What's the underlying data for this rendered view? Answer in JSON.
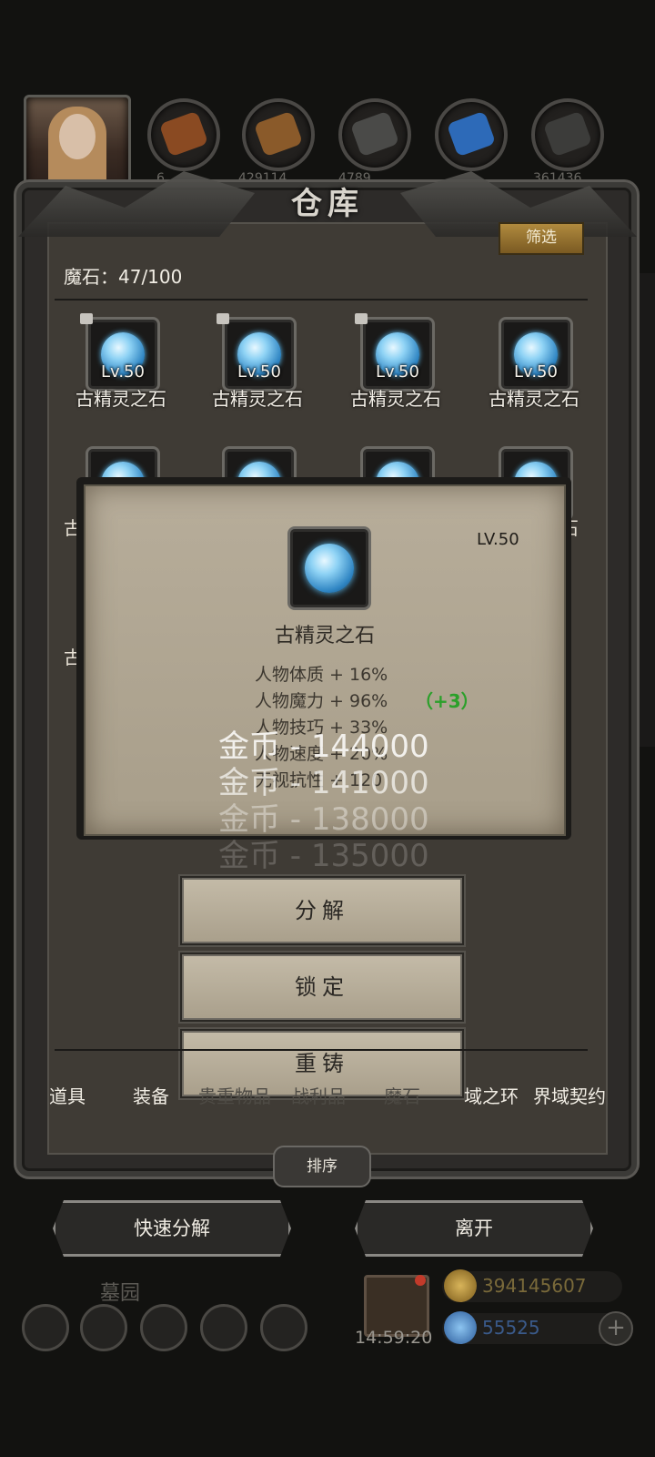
{
  "top_resources": {
    "values": [
      "6",
      "429114",
      "4789",
      "",
      "361436"
    ]
  },
  "panel": {
    "title": "仓库",
    "filter_label": "筛选",
    "stone_count": "魔石：47/100"
  },
  "grid_items": [
    {
      "level": "Lv.50",
      "name": "古精灵之石",
      "locked": true
    },
    {
      "level": "Lv.50",
      "name": "古精灵之石",
      "locked": true
    },
    {
      "level": "Lv.50",
      "name": "古精灵之石",
      "locked": true
    },
    {
      "level": "Lv.50",
      "name": "古精灵之石",
      "locked": false
    }
  ],
  "row2_partial_names": [
    "古",
    "石"
  ],
  "row3_partial_name": "古",
  "detail": {
    "level": "LV.50",
    "name": "古精灵之石",
    "stats": [
      "人物体质 + 16%",
      "人物魔力 + 96%",
      "人物技巧 + 33%",
      "人物速度 + 20%",
      "无视抗性 + 120"
    ],
    "bonus": "（+3）"
  },
  "gold_floats": [
    "金币 - 144000",
    "金币 - 141000",
    "金币 - 138000",
    "金币 - 135000"
  ],
  "actions": {
    "decompose": "分解",
    "lock": "锁定",
    "reforge": "重铸"
  },
  "tabs": [
    "道具",
    "装备",
    "贵重物品",
    "战利品",
    "魔石",
    "界域之环",
    "界域契约"
  ],
  "sort_label": "排序",
  "bottom_buttons": {
    "quick_decompose": "快速分解",
    "leave": "离开"
  },
  "hud": {
    "location": "墓园",
    "timer": "14:59:20",
    "gold": "394145607",
    "gems": "55525",
    "plus": "+"
  }
}
